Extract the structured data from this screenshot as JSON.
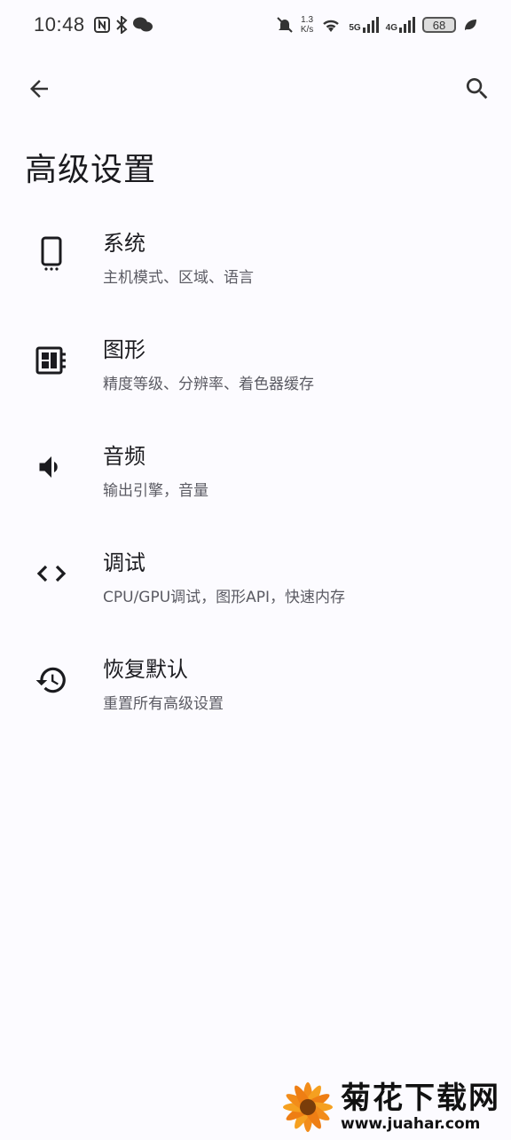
{
  "status_bar": {
    "time": "10:48",
    "speed_value": "1.3",
    "speed_unit": "K/s",
    "net1": "5G",
    "net2": "4G",
    "battery": "68",
    "icons": [
      "nfc-icon",
      "bluetooth-icon",
      "wechat-icon",
      "mute-icon",
      "wifi-icon",
      "signal-icon",
      "battery-icon",
      "leaf-icon"
    ]
  },
  "header": {
    "title": "高级设置",
    "back_icon": "arrow-left-icon",
    "search_icon": "search-icon"
  },
  "menu": [
    {
      "title": "系统",
      "subtitle": "主机模式、区域、语言",
      "icon": "phone-icon"
    },
    {
      "title": "图形",
      "subtitle": "精度等级、分辨率、着色器缓存",
      "icon": "chip-icon"
    },
    {
      "title": "音频",
      "subtitle": "输出引擎，音量",
      "icon": "speaker-icon"
    },
    {
      "title": "调试",
      "subtitle": "CPU/GPU调试，图形API，快速内存",
      "icon": "code-icon"
    },
    {
      "title": "恢复默认",
      "subtitle": "重置所有高级设置",
      "icon": "history-icon"
    }
  ],
  "watermark": {
    "name": "菊花下载网",
    "url": "www.juahar.com"
  }
}
